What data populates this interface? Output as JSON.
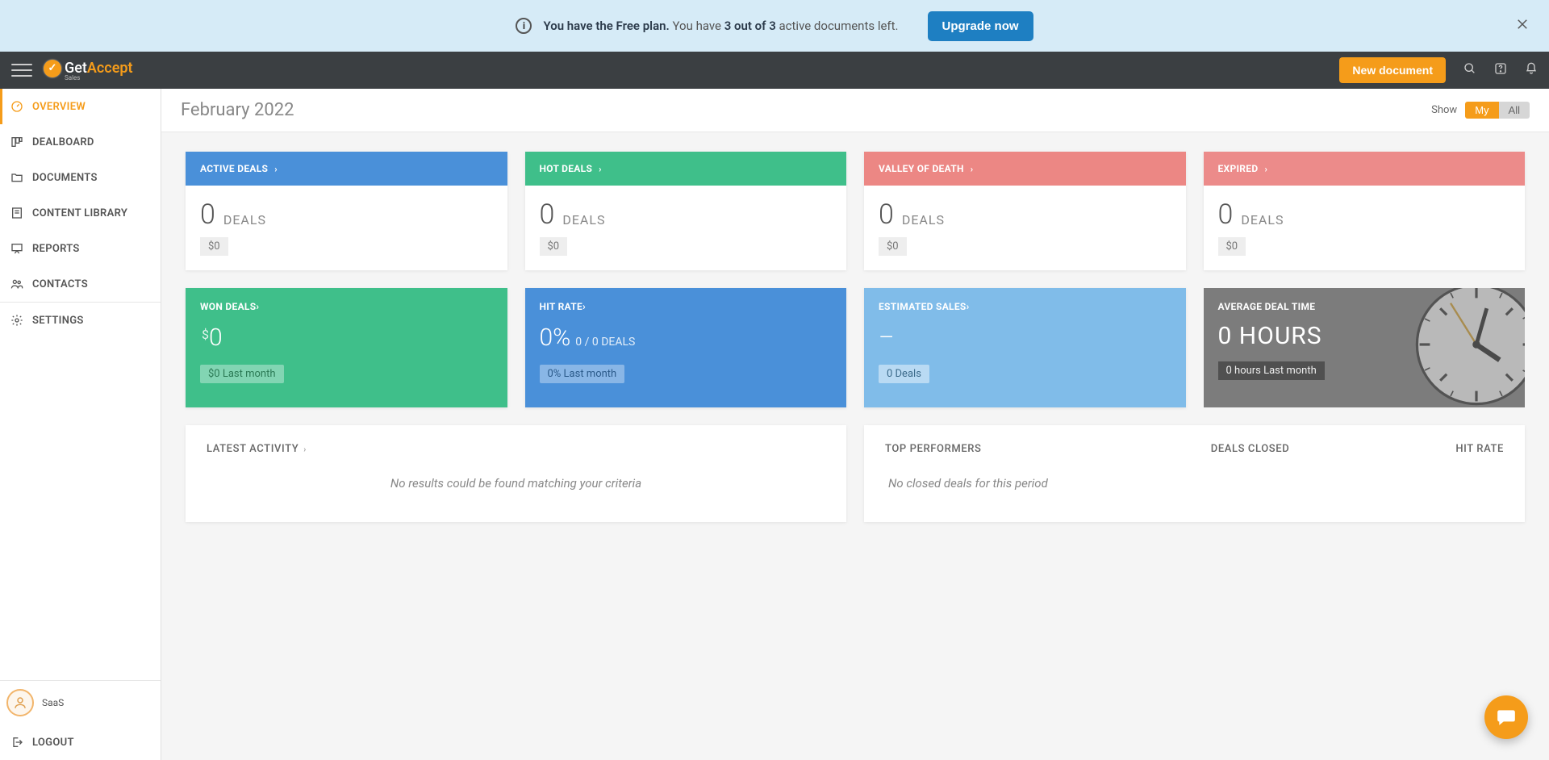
{
  "banner": {
    "text_bold_prefix": "You have the Free plan.",
    "text_mid": " You have ",
    "count_bold": "3 out of 3",
    "text_suffix": " active documents left.",
    "upgrade_label": "Upgrade now"
  },
  "topbar": {
    "logo_get": "Get",
    "logo_accept": "Accept",
    "logo_sub": "Sales",
    "new_document_label": "New document"
  },
  "sidebar": {
    "items": [
      {
        "label": "OVERVIEW"
      },
      {
        "label": "DEALBOARD"
      },
      {
        "label": "DOCUMENTS"
      },
      {
        "label": "CONTENT LIBRARY"
      },
      {
        "label": "REPORTS"
      },
      {
        "label": "CONTACTS"
      },
      {
        "label": "SETTINGS"
      }
    ],
    "user_name": "SaaS",
    "logout_label": "LOGOUT"
  },
  "header": {
    "title": "February 2022",
    "show_label": "Show",
    "toggle_my": "My",
    "toggle_all": "All"
  },
  "cards_row1": [
    {
      "title": "ACTIVE DEALS",
      "count": "0",
      "unit": "DEALS",
      "amount": "$0",
      "color": "c-blue"
    },
    {
      "title": "HOT DEALS",
      "count": "0",
      "unit": "DEALS",
      "amount": "$0",
      "color": "c-green"
    },
    {
      "title": "VALLEY OF DEATH",
      "count": "0",
      "unit": "DEALS",
      "amount": "$0",
      "color": "c-pink"
    },
    {
      "title": "EXPIRED",
      "count": "0",
      "unit": "DEALS",
      "amount": "$0",
      "color": "c-pink2"
    }
  ],
  "cards_row2": {
    "won": {
      "title": "WON DEALS",
      "currency": "$",
      "value": "0",
      "badge": "$0 Last month"
    },
    "hit": {
      "title": "HIT RATE",
      "value": "0%",
      "sub": "0 / 0  DEALS",
      "badge": "0% Last month"
    },
    "est": {
      "title": "ESTIMATED SALES",
      "value": "–",
      "badge": "0 Deals"
    },
    "avg": {
      "title": "AVERAGE DEAL TIME",
      "value": "0 HOURS",
      "badge": "0 hours Last month"
    }
  },
  "panels": {
    "latest_activity": {
      "title": "LATEST ACTIVITY",
      "empty": "No results could be found matching your criteria"
    },
    "top_performers": {
      "title": "TOP PERFORMERS",
      "col_deals": "DEALS CLOSED",
      "col_hit": "HIT RATE",
      "empty": "No closed deals for this period"
    }
  }
}
